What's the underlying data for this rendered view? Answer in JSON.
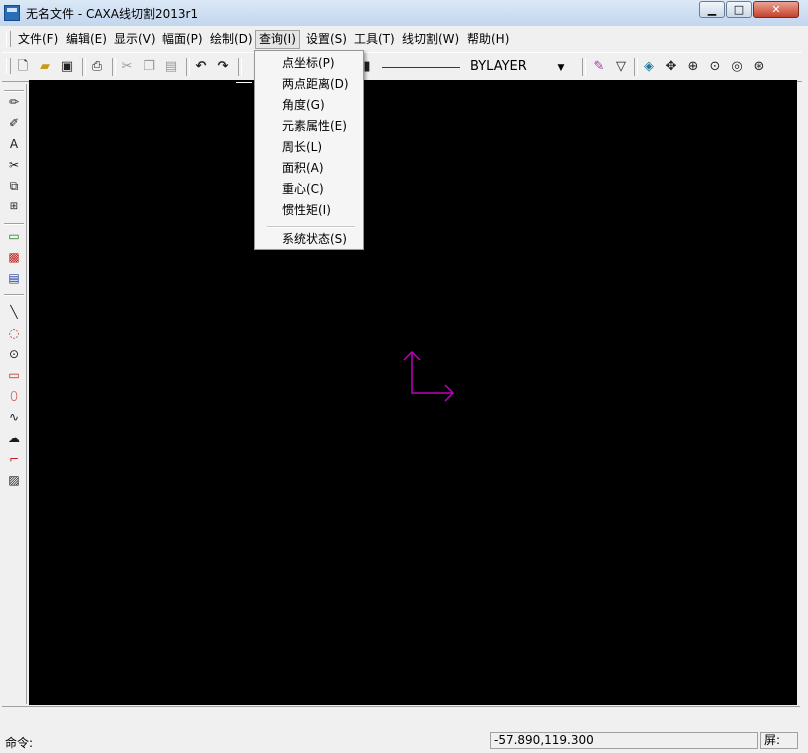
{
  "window": {
    "title": "无名文件 - CAXA线切割2013r1"
  },
  "menubar": {
    "items": [
      {
        "label": "文件(F)"
      },
      {
        "label": "编辑(E)"
      },
      {
        "label": "显示(V)"
      },
      {
        "label": "幅面(P)"
      },
      {
        "label": "绘制(D)"
      },
      {
        "label": "查询(I)"
      },
      {
        "label": "设置(S)"
      },
      {
        "label": "工具(T)"
      },
      {
        "label": "线切割(W)"
      },
      {
        "label": "帮助(H)"
      }
    ]
  },
  "query_menu": {
    "items": [
      {
        "label": "点坐标(P)"
      },
      {
        "label": "两点距离(D)"
      },
      {
        "label": "角度(G)"
      },
      {
        "label": "元素属性(E)"
      },
      {
        "label": "周长(L)"
      },
      {
        "label": "面积(A)"
      },
      {
        "label": "重心(C)"
      },
      {
        "label": "惯性矩(I)"
      },
      {
        "label": "系统状态(S)"
      }
    ]
  },
  "toolbar": {
    "layer_value": "BYLAYER"
  },
  "canvas": {
    "background": "#000000",
    "axis_color": "#c000c0"
  },
  "status": {
    "command_label": "命令:",
    "coordinates": "-57.890,119.300",
    "screen_label": "屏:"
  }
}
